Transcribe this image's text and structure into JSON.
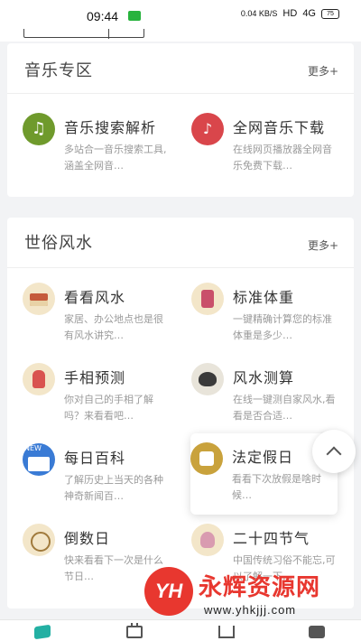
{
  "status_bar": {
    "time": "09:44",
    "net_speed": "0.04 KB/S",
    "hd": "HD",
    "signal": "4G",
    "battery": "75"
  },
  "music_section": {
    "title": "音乐专区",
    "more": "更多+",
    "items": [
      {
        "name": "音乐搜索解析",
        "desc": "多站合一音乐搜索工具,涵盖全网音…",
        "icon": "music-note-icon"
      },
      {
        "name": "全网音乐下载",
        "desc": "在线网页播放器全网音乐免费下载…",
        "icon": "music-download-icon"
      }
    ]
  },
  "fengshui_section": {
    "title": "世俗风水",
    "more": "更多+",
    "items": [
      {
        "name": "看看风水",
        "desc": "家居、办公地点也是很有风水讲究…",
        "icon": "house-icon"
      },
      {
        "name": "标准体重",
        "desc": "一键精确计算您的标准体重是多少…",
        "icon": "weight-icon"
      },
      {
        "name": "手相预测",
        "desc": "你对自己的手相了解吗？来看看吧…",
        "icon": "palm-icon"
      },
      {
        "name": "风水测算",
        "desc": "在线一键测自家风水,看看是否合适…",
        "icon": "fengshui-icon"
      },
      {
        "name": "每日百科",
        "desc": "了解历史上当天的各种神奇新闻百…",
        "icon": "news-icon"
      },
      {
        "name": "法定假日",
        "desc": "看看下次放假是啥时候…",
        "icon": "holiday-icon"
      },
      {
        "name": "倒数日",
        "desc": "快来看看下一次是什么节日…",
        "icon": "countdown-clock-icon"
      },
      {
        "name": "二十四节气",
        "desc": "中国传统习俗不能忘,可以了解一下…",
        "icon": "solar-term-icon"
      }
    ]
  },
  "bottom_nav": {
    "tabs": [
      "home-tab-icon",
      "calendar-tab-icon",
      "tools-tab-icon",
      "mine-tab-icon"
    ]
  },
  "watermark": {
    "logo": "YH",
    "brand": "永辉资源网",
    "url": "www.yhkjjj.com"
  }
}
